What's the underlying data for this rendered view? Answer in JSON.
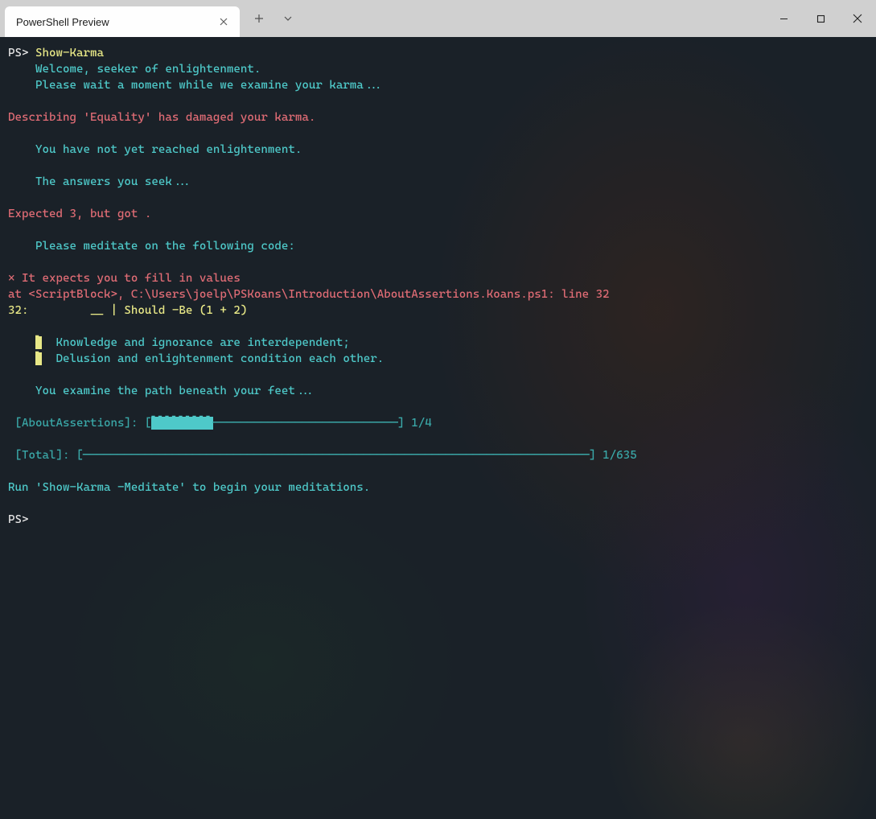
{
  "window": {
    "tab_title": "PowerShell Preview"
  },
  "terminal": {
    "prompt1": "PS>",
    "command": "Show-Karma",
    "welcome1": "    Welcome, seeker of enlightenment.",
    "welcome2": "    Please wait a moment while we examine your karma...",
    "err_describe": "Describing 'Equality' has damaged your karma.",
    "not_reached": "    You have not yet reached enlightenment.",
    "answers_seek": "    The answers you seek...",
    "expected": "Expected 3, but got .",
    "meditate_on": "    Please meditate on the following code:",
    "fill_values": "× It expects you to fill in values",
    "at_line": "at <ScriptBlock>, C:\\Users\\joelp\\PSKoans\\Introduction\\AboutAssertions.Koans.ps1: line 32",
    "code_line": "32:         __ | Should -Be (1 + 2)",
    "koan1": "Knowledge and ignorance are interdependent;",
    "koan2": "Delusion and enlightenment condition each other.",
    "examine_path": "    You examine the path beneath your feet...",
    "progress1_label": " [AboutAssertions]: [",
    "progress1_fill": "▌▌▌▌▌▌▌▌▌",
    "progress1_empty": "───────────────────────────",
    "progress1_end": "] 1/4",
    "progress2_label": " [Total]: [",
    "progress2_empty": "──────────────────────────────────────────────────────────────────────────",
    "progress2_end": "] 1/635",
    "run_meditate": "Run 'Show-Karma -Meditate' to begin your meditations.",
    "prompt2": "PS>"
  }
}
